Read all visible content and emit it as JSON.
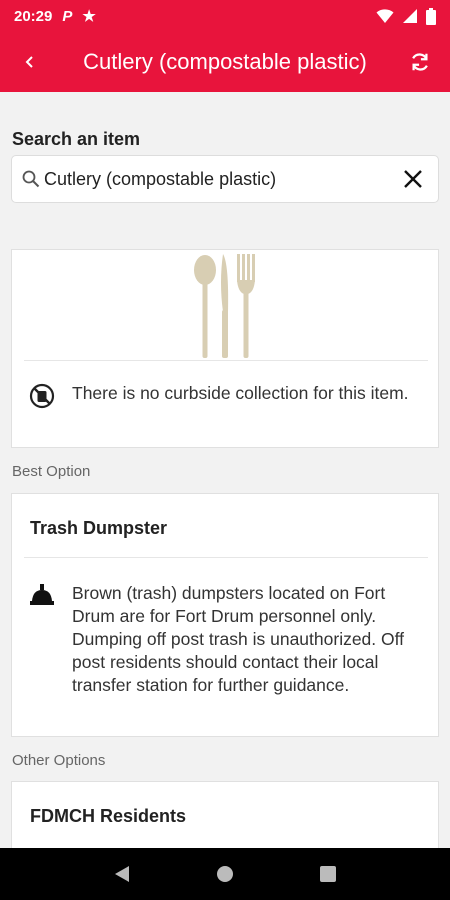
{
  "status_bar": {
    "time": "20:29",
    "p_icon": "P"
  },
  "app_bar": {
    "title": "Cutlery (compostable plastic)"
  },
  "search": {
    "label": "Search an item",
    "value": "Cutlery (compostable plastic)"
  },
  "item_card": {
    "notice": "There is no curbside collection for this item."
  },
  "best_option": {
    "section_label": "Best Option",
    "title": "Trash Dumpster",
    "description": "Brown (trash) dumpsters located on Fort Drum are for Fort Drum personnel only.  Dumping off post trash is unauthorized. Off post residents should contact their local transfer station for further guidance."
  },
  "other_options": {
    "section_label": "Other Options",
    "title": "FDMCH Residents"
  },
  "colors": {
    "brand": "#e8143c"
  }
}
